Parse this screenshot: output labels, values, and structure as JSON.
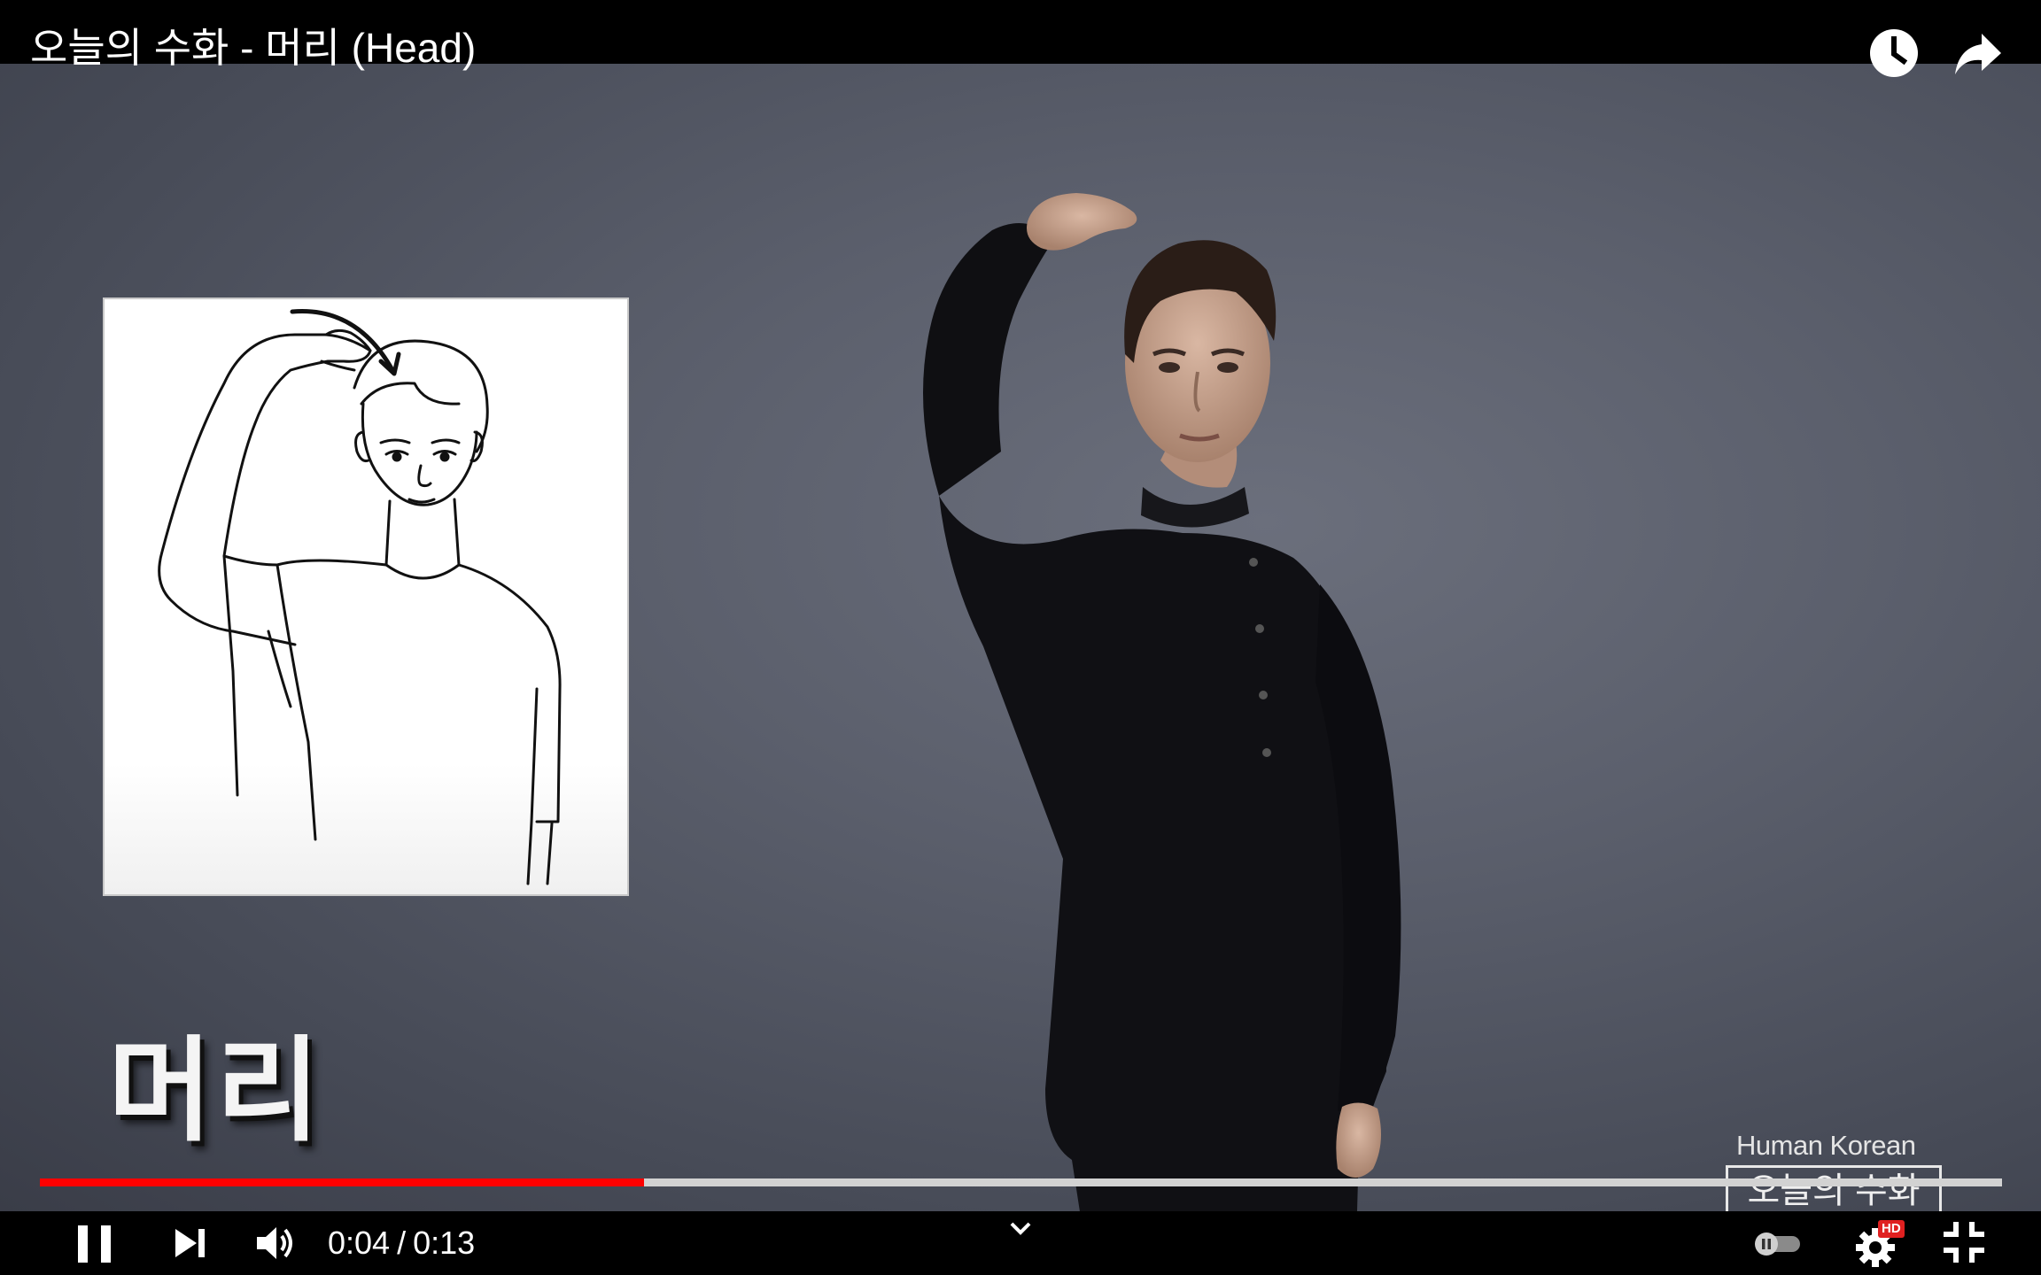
{
  "header": {
    "title": "오늘의 수화 - 머리 (Head)",
    "watch_later_icon": "clock-icon",
    "share_icon": "share-arrow-icon"
  },
  "video": {
    "caption_word": "머리",
    "watermark": {
      "line1": "Human Korean",
      "line2": "오늘의 수화"
    }
  },
  "progress": {
    "played_fraction": 0.308,
    "played_color": "#ff0000",
    "track_color": "#d2d2d2"
  },
  "controls": {
    "current_time": "0:04",
    "separator": "/",
    "duration": "0:13",
    "play_icon": "pause-icon",
    "next_icon": "skip-next-icon",
    "volume_icon": "volume-icon",
    "more_icon": "chevron-down-icon",
    "autoplay_icon": "autoplay-toggle-icon",
    "settings_icon": "gear-icon",
    "hd_badge": "HD",
    "fullscreen_icon": "exit-fullscreen-icon"
  }
}
